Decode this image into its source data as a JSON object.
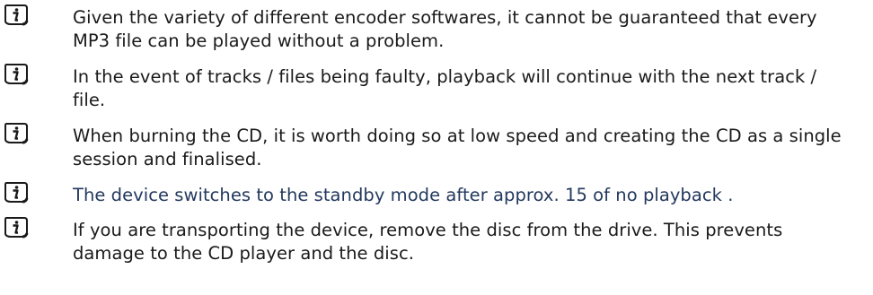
{
  "notes": [
    {
      "icon": "info-icon",
      "text": "Given the variety of different encoder softwares, it cannot be guaranteed that every MP3 file can be played without a problem."
    },
    {
      "icon": "info-icon",
      "text": "In the event of tracks / files being faulty, playback will continue with the next track / file."
    },
    {
      "icon": "info-icon",
      "text": "When burning the CD, it is worth doing so at low speed and creating the CD as a single session and finalised."
    },
    {
      "icon": "info-icon",
      "text": "The device switches to the standby mode after approx. 15 of no playback ."
    },
    {
      "icon": "info-icon",
      "text": "If you are transporting the device, remove the disc from the drive. This prevents damage to the CD player and the disc."
    }
  ]
}
